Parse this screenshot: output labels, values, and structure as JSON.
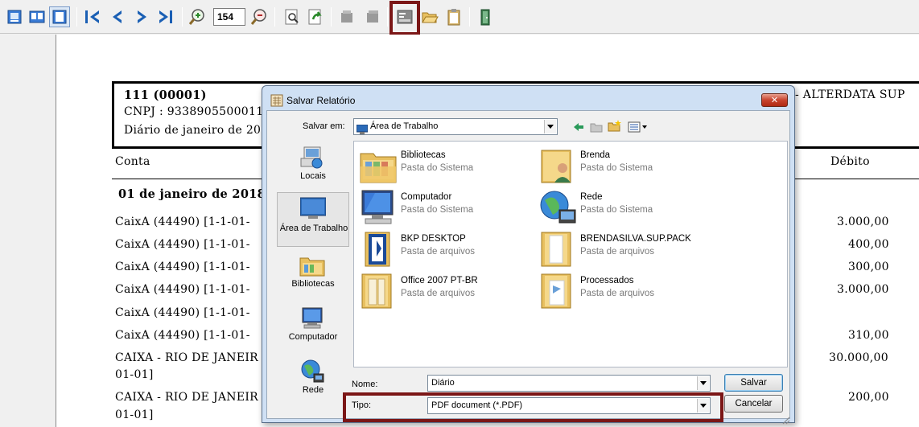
{
  "toolbar": {
    "zoom_value": "154",
    "icons": [
      "page-single-icon",
      "page-two-icon",
      "page-fit-icon",
      "first-page-icon",
      "prev-page-icon",
      "next-page-icon",
      "last-page-icon",
      "zoom-in-icon",
      "zoom-out-icon",
      "find-icon",
      "refresh-icon",
      "print-icon",
      "print-setup-icon",
      "export-icon",
      "open-icon",
      "clipboard-icon",
      "exit-icon"
    ]
  },
  "report": {
    "company_code": "111 (00001)",
    "cnpj": "CNPJ : 9338905500011",
    "title": "Diário de janeiro de 201",
    "company_right": "- ALTERDATA SUP",
    "col_conta": "Conta",
    "col_debito": "Débito",
    "date": "01 de janeiro de 2018",
    "rows": [
      {
        "conta": "CaixA (44490)   [1-1-01-",
        "debito": "3.000,00"
      },
      {
        "conta": "CaixA (44490)   [1-1-01-",
        "debito": "400,00"
      },
      {
        "conta": "CaixA (44490)   [1-1-01-",
        "debito": "300,00"
      },
      {
        "conta": "CaixA (44490)   [1-1-01-",
        "debito": "3.000,00"
      },
      {
        "conta": "CaixA (44490)   [1-1-01-",
        "debito": ""
      },
      {
        "conta": "CaixA (44490)   [1-1-01-",
        "debito": "310,00"
      },
      {
        "conta": "CAIXA - RIO DE JANEIR",
        "conta2": "01-01]",
        "debito": "30.000,00"
      },
      {
        "conta": "CAIXA - RIO DE JANEIR",
        "conta2": "01-01]",
        "debito": "200,00"
      }
    ]
  },
  "dialog": {
    "title": "Salvar Relatório",
    "close_label": "✕",
    "save_in_label": "Salvar em:",
    "save_in_value": "Área de Trabalho",
    "places": [
      {
        "label": "Locais"
      },
      {
        "label": "Área de Trabalho"
      },
      {
        "label": "Bibliotecas"
      },
      {
        "label": "Computador"
      },
      {
        "label": "Rede"
      }
    ],
    "files": [
      {
        "name": "Bibliotecas",
        "type": "Pasta do Sistema",
        "icon": "libraries-folder-icon"
      },
      {
        "name": "Brenda",
        "type": "Pasta do Sistema",
        "icon": "user-folder-icon"
      },
      {
        "name": "Computador",
        "type": "Pasta do Sistema",
        "icon": "computer-icon"
      },
      {
        "name": "Rede",
        "type": "Pasta do Sistema",
        "icon": "network-icon"
      },
      {
        "name": "BKP DESKTOP",
        "type": "Pasta de arquivos",
        "icon": "folder-icon"
      },
      {
        "name": "BRENDASILVA.SUP.PACK",
        "type": "Pasta de arquivos",
        "icon": "folder-icon"
      },
      {
        "name": "Office 2007 PT-BR",
        "type": "Pasta de arquivos",
        "icon": "folder-icon"
      },
      {
        "name": "Processados",
        "type": "Pasta de arquivos",
        "icon": "folder-icon"
      }
    ],
    "name_label": "Nome:",
    "name_value": "Diário",
    "type_label": "Tipo:",
    "type_value": "PDF document (*.PDF)",
    "save_button": "Salvar",
    "cancel_button": "Cancelar"
  },
  "colors": {
    "highlight": "#7b1616",
    "toolbar_blue": "#1a5fb4",
    "dialog_frame": "#cfe0f4"
  }
}
